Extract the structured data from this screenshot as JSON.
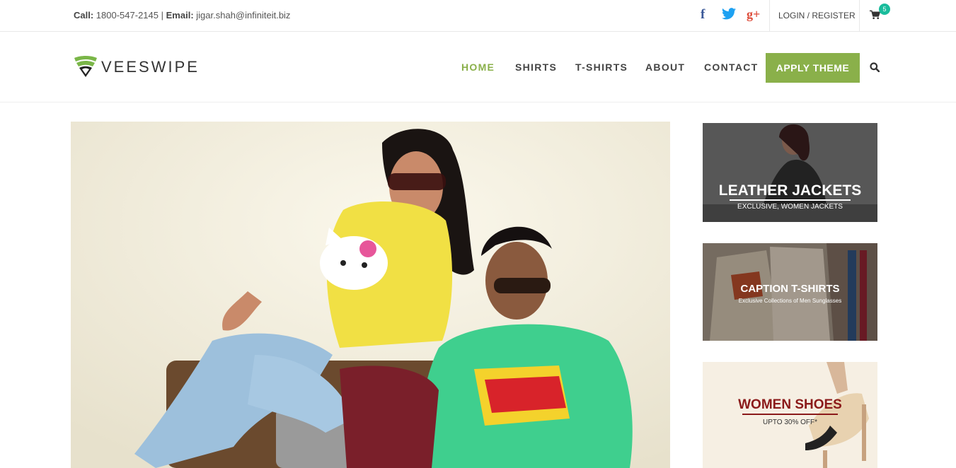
{
  "topbar": {
    "call_label": "Call:",
    "phone": "1800-547-2145",
    "separator": "|",
    "email_label": "Email:",
    "email": "jigar.shah@infiniteit.biz",
    "login_register": "LOGIN / REGISTER",
    "cart_count": "5",
    "social_facebook": "f",
    "social_google_plus": "g+"
  },
  "header": {
    "logo_text": "VEESWIPE",
    "nav": [
      "HOME",
      "SHIRTS",
      "T-SHIRTS",
      "ABOUT",
      "CONTACT"
    ],
    "apply_button": "APPLY THEME"
  },
  "banners": [
    {
      "title": "LEATHER JACKETS",
      "subtitle": "EXCLUSIVE, WOMEN JACKETS"
    },
    {
      "title": "CAPTION T-SHIRTS",
      "subtitle": "Exclusive Collections of Men Sunglasses"
    },
    {
      "title": "WOMEN SHOES",
      "subtitle": "UPTO 30% OFF*"
    }
  ],
  "colors": {
    "accent": "#8ab04a",
    "badge": "#1abc9c",
    "facebook": "#3b5998",
    "twitter": "#1da1f2",
    "google_plus": "#dd4b39",
    "shoes_title": "#8b1a1a"
  }
}
